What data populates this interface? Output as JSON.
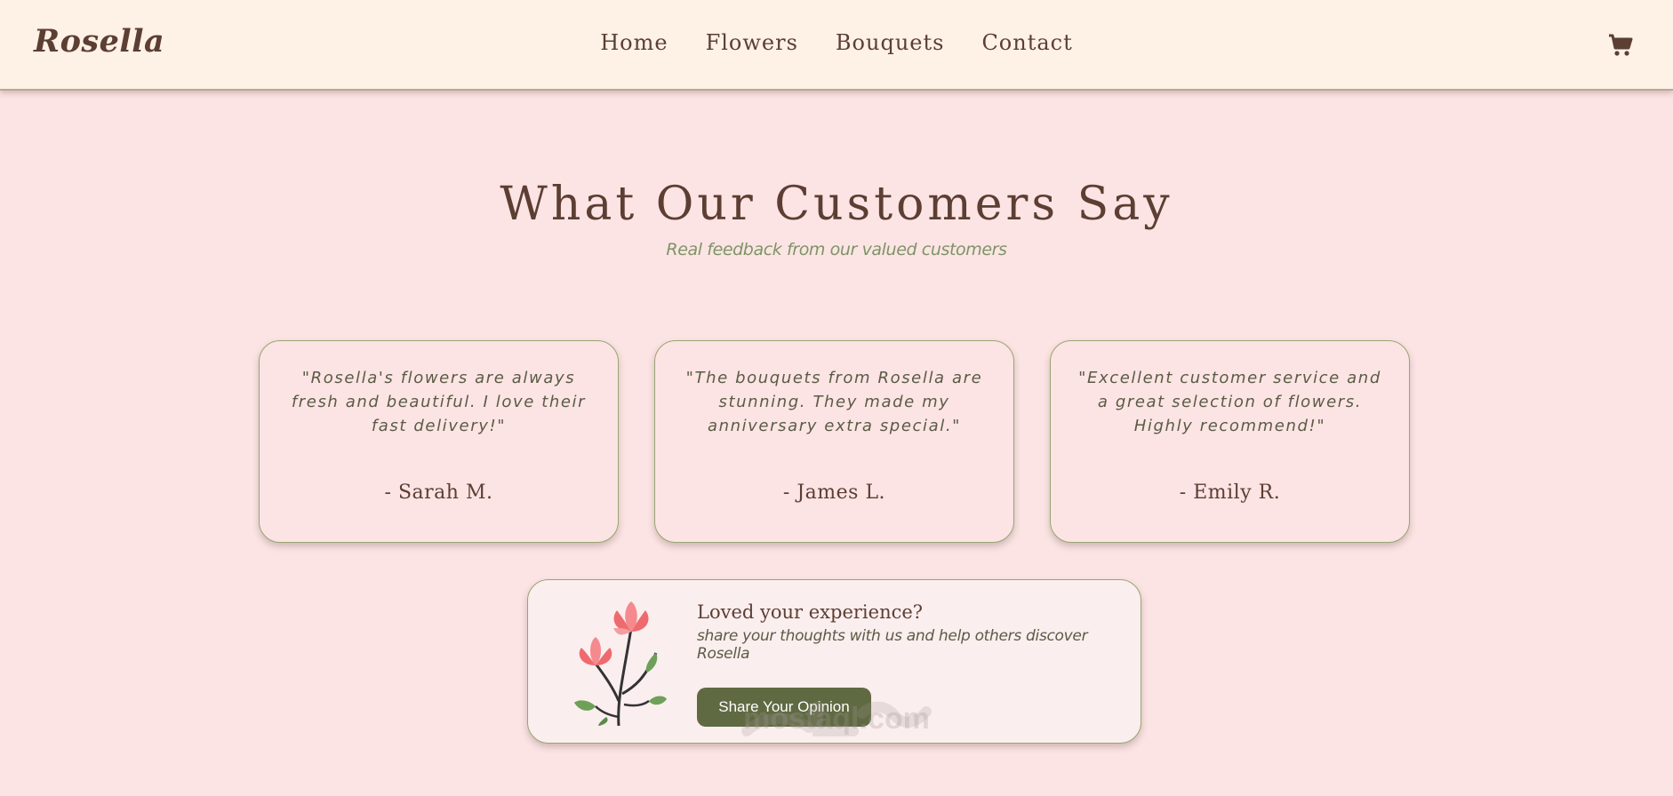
{
  "header": {
    "brand": "Rosella",
    "nav": [
      "Home",
      "Flowers",
      "Bouquets",
      "Contact"
    ],
    "cart_icon": "cart-icon"
  },
  "section": {
    "title": "What Our Customers Say",
    "subtitle": "Real feedback from our valued customers"
  },
  "testimonials": [
    {
      "quote": "\"Rosella's flowers are always fresh and beautiful. I love their fast delivery!\"",
      "author": "- Sarah M."
    },
    {
      "quote": "\"The bouquets from Rosella are stunning. They made my anniversary extra special.\"",
      "author": "- James L."
    },
    {
      "quote": "\"Excellent customer service and a great selection of flowers. Highly recommend!\"",
      "author": "- Emily R."
    }
  ],
  "cta": {
    "heading": "Loved your experience?",
    "text": "share your thoughts with us and help others discover Rosella",
    "button": "Share Your Opinion",
    "image_icon": "flower-illustration-icon"
  },
  "watermark": {
    "text": "mostaql.com"
  },
  "colors": {
    "background": "#fce4e4",
    "header": "#fef1e6",
    "brown": "#5c3e33",
    "olive": "#7e9466",
    "button": "#606a42"
  }
}
